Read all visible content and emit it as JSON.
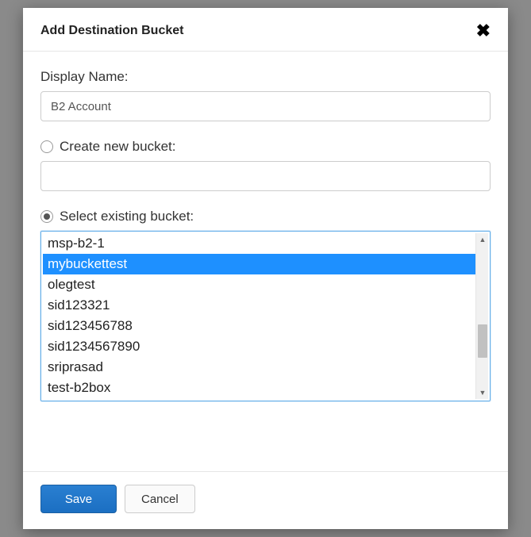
{
  "modal": {
    "title": "Add Destination Bucket",
    "close_glyph": "✖"
  },
  "display_name": {
    "label": "Display Name:",
    "value": "B2 Account"
  },
  "create_bucket": {
    "label": "Create new bucket:",
    "checked": false,
    "value": ""
  },
  "select_bucket": {
    "label": "Select existing bucket:",
    "checked": true,
    "selected": "mybuckettest",
    "options": [
      "msp-b2-1",
      "mybuckettest",
      "olegtest",
      "sid123321",
      "sid123456788",
      "sid1234567890",
      "sriprasad",
      "test-b2box"
    ]
  },
  "footer": {
    "save_label": "Save",
    "cancel_label": "Cancel"
  }
}
